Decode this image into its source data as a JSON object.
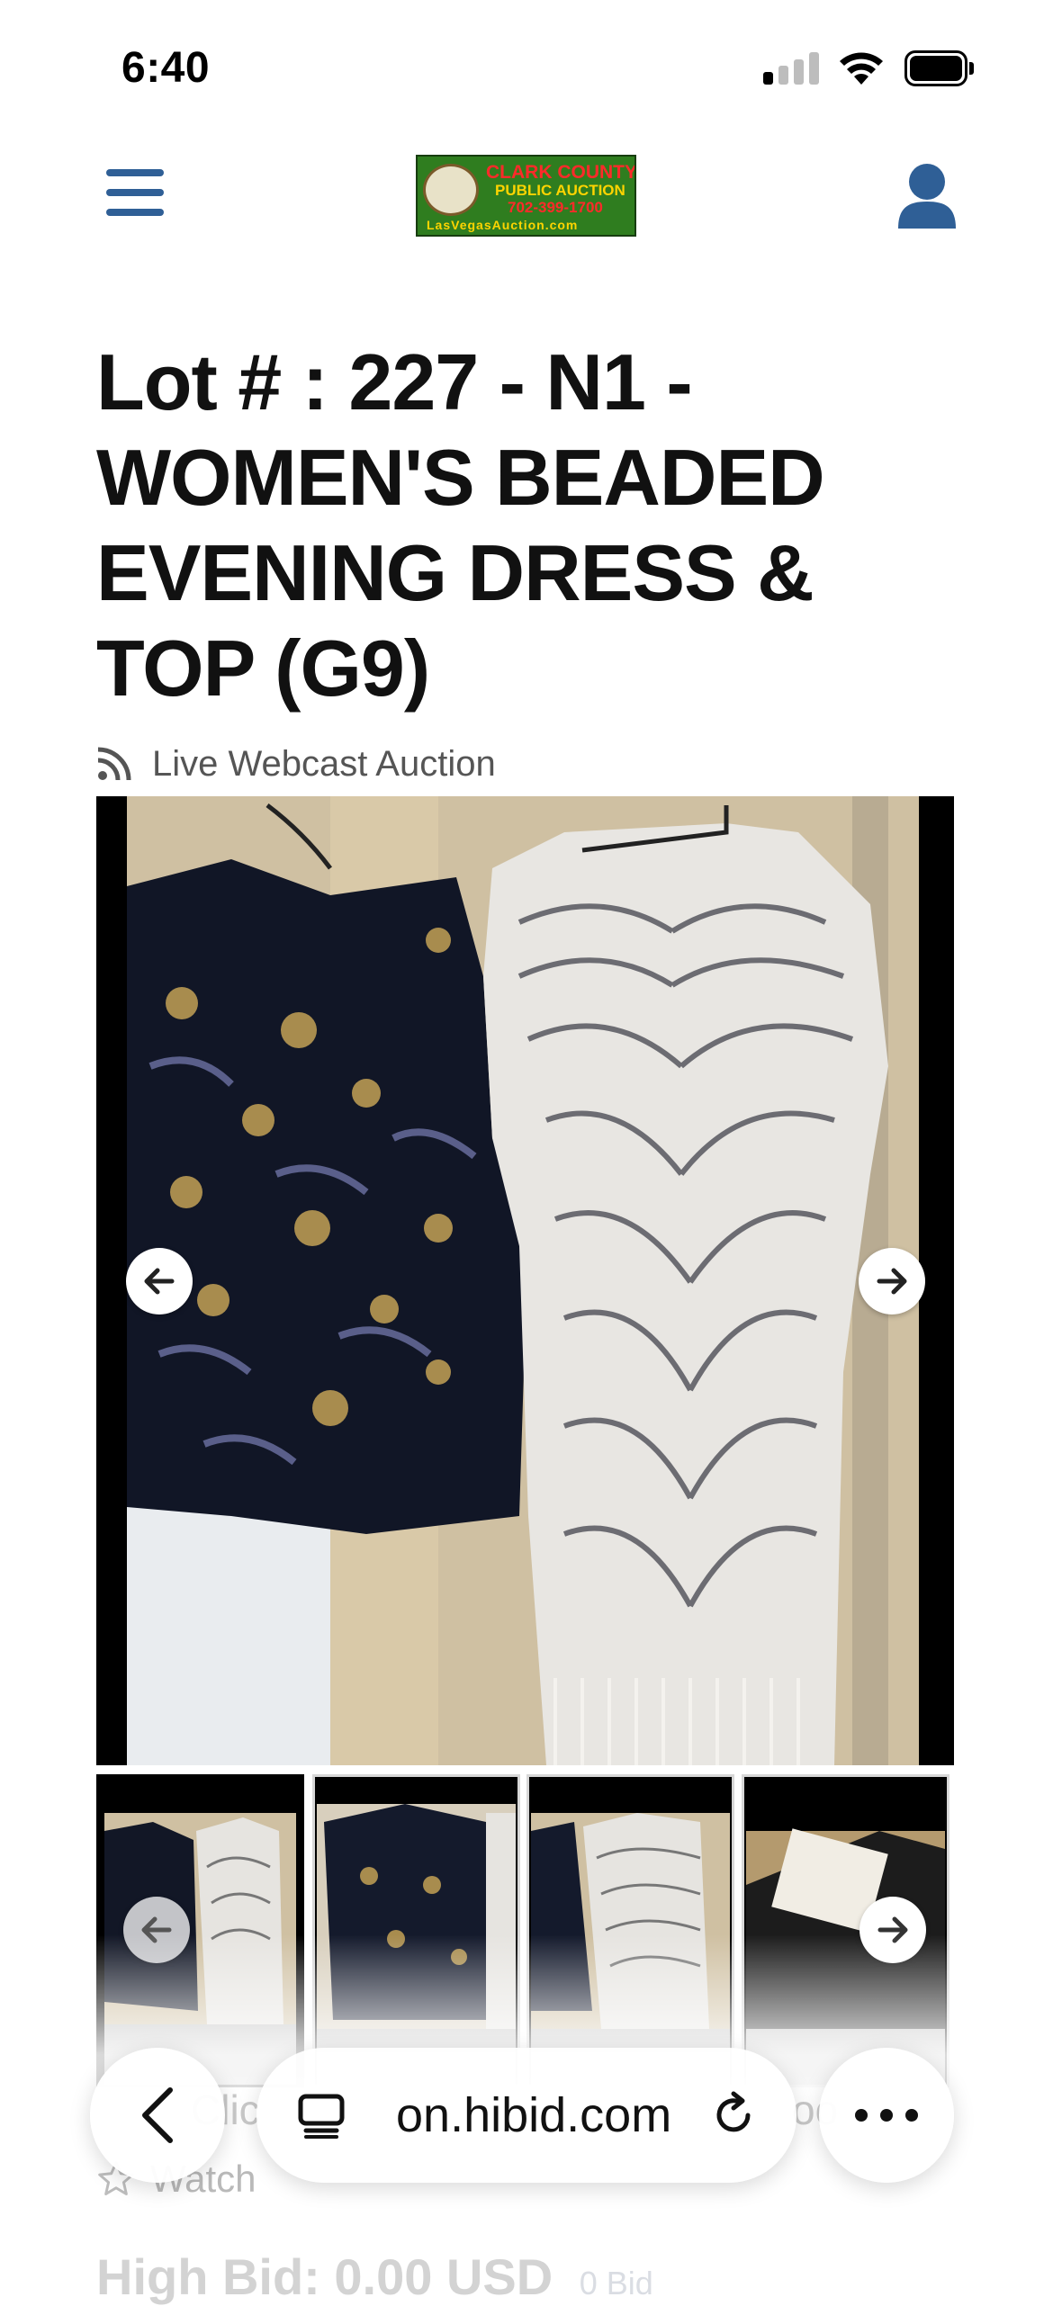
{
  "status_bar": {
    "time": "6:40"
  },
  "header": {
    "logo": {
      "line1": "CLARK COUNTY",
      "line2": "PUBLIC AUCTION",
      "line3": "702-399-1700",
      "line4": "LasVegasAuction.com"
    }
  },
  "lot": {
    "title": "Lot # : 227 - N1 - WOMEN'S BEADED EVENING DRESS & TOP (G9)",
    "auction_type": "Live Webcast Auction"
  },
  "gallery": {
    "thumbnail_count": 4,
    "selected_index": 0
  },
  "actions": {
    "watch_label": "Watch"
  },
  "bid": {
    "high_bid": "High Bid: 0.00 USD",
    "bids_count": "0 Bid"
  },
  "browser": {
    "url": "on.hibid.com",
    "ghost_left": "Clic",
    "ghost_right": "oo"
  },
  "colors": {
    "brand_blue": "#2f5f96",
    "text_dark": "#111111",
    "muted": "#555555"
  }
}
